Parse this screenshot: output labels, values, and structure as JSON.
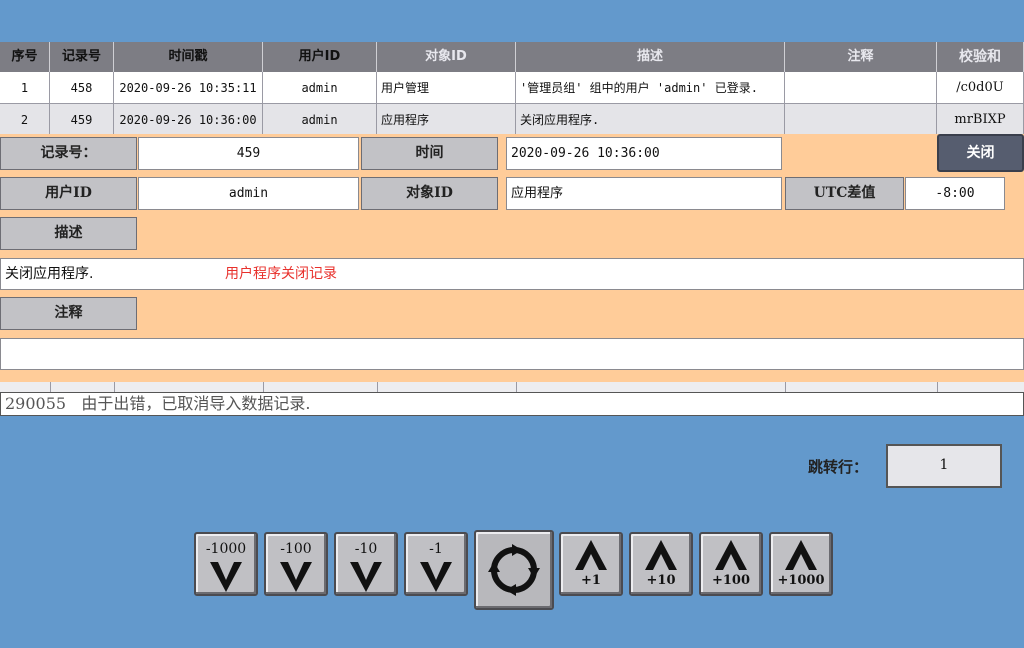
{
  "table": {
    "headers": [
      "序号",
      "记录号",
      "时间戳",
      "用户ID",
      "对象ID",
      "描述",
      "注释",
      "校验和"
    ],
    "rows": [
      [
        "1",
        "458",
        "2020-09-26 10:35:11",
        "admin",
        "用户管理",
        "'管理员组' 组中的用户 'admin' 已登录.",
        "",
        "/c0d0U"
      ],
      [
        "2",
        "459",
        "2020-09-26 10:36:00",
        "admin",
        "应用程序",
        "关闭应用程序.",
        "",
        "mrBIXP"
      ]
    ]
  },
  "detail": {
    "record_label": "记录号：",
    "record_value": "459",
    "time_label": "时间",
    "time_value": "2020-09-26 10:36:00",
    "close_label": "关闭",
    "user_label": "用户ID",
    "user_value": "admin",
    "object_label": "对象ID",
    "object_value": "应用程序",
    "utc_label": "UTC差值",
    "utc_value": "-8:00",
    "desc_label": "描述",
    "desc_value": "关闭应用程序.",
    "desc_note": "用户程序关闭记录",
    "comment_label": "注释",
    "comment_value": ""
  },
  "alarm": {
    "text": "290055   由于出错，已取消导入数据记录."
  },
  "jump": {
    "label": "跳转行：",
    "value": "1"
  },
  "nav": {
    "down_buttons": [
      "-1000",
      "-100",
      "-10",
      "-1"
    ],
    "refresh_icon": "refresh-icon",
    "up_buttons": [
      "+1",
      "+10",
      "+100",
      "+1000"
    ]
  },
  "colors": {
    "background": "#6399cc",
    "panel": "#ffcc99",
    "header": "#7d7d84",
    "note": "#e8312c"
  }
}
